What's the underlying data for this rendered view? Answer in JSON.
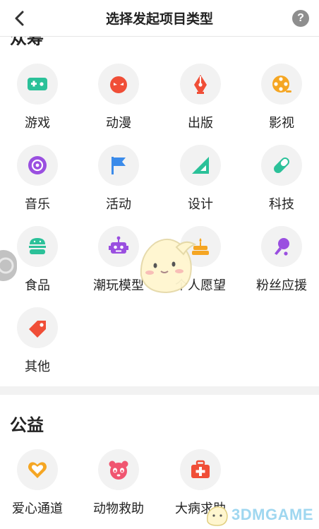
{
  "header": {
    "title": "选择发起项目类型",
    "help": "?"
  },
  "sections": [
    {
      "title": "众筹",
      "items": [
        {
          "label": "游戏",
          "icon": "gamepad-icon"
        },
        {
          "label": "动漫",
          "icon": "anime-mask-icon"
        },
        {
          "label": "出版",
          "icon": "pen-nib-icon"
        },
        {
          "label": "影视",
          "icon": "film-reel-icon"
        },
        {
          "label": "音乐",
          "icon": "vinyl-icon"
        },
        {
          "label": "活动",
          "icon": "flag-icon"
        },
        {
          "label": "设计",
          "icon": "set-square-icon"
        },
        {
          "label": "科技",
          "icon": "capsule-icon"
        },
        {
          "label": "食品",
          "icon": "burger-icon"
        },
        {
          "label": "潮玩模型",
          "icon": "robot-icon"
        },
        {
          "label": "个人愿望",
          "icon": "cake-icon"
        },
        {
          "label": "粉丝应援",
          "icon": "microphone-icon"
        },
        {
          "label": "其他",
          "icon": "tag-icon"
        }
      ]
    },
    {
      "title": "公益",
      "items": [
        {
          "label": "爱心通道",
          "icon": "heart-icon"
        },
        {
          "label": "动物救助",
          "icon": "panda-icon"
        },
        {
          "label": "大病求助",
          "icon": "first-aid-kit-icon"
        }
      ]
    }
  ],
  "watermark": "3DMGAME",
  "colors": {
    "green": "#2bc199",
    "red": "#f04e37",
    "blue": "#3b8bea",
    "purple": "#9a4fe0",
    "orange": "#f5a623",
    "pink": "#f05570"
  }
}
